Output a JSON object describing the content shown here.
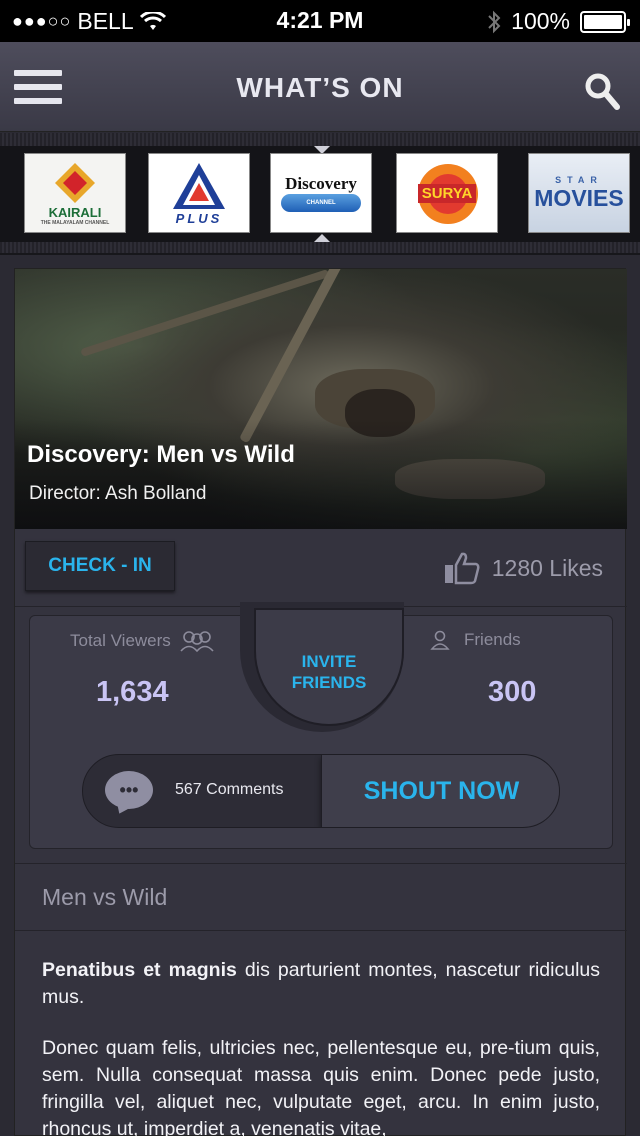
{
  "status_bar": {
    "signal": "●●●○○",
    "carrier": "BELL",
    "time": "4:21 PM",
    "battery": "100%"
  },
  "header": {
    "title": "WHAT’S ON"
  },
  "channels": [
    {
      "name": "KAIRALI",
      "sub": "THE MALAYALAM CHANNEL"
    },
    {
      "name": "PLUS",
      "sub": ""
    },
    {
      "name": "Discovery",
      "sub": "CHANNEL"
    },
    {
      "name": "SURYA",
      "sub": ""
    },
    {
      "name": "MOVIES",
      "sub": "STAR"
    }
  ],
  "show": {
    "title": "Discovery: Men vs Wild",
    "director": "Director: Ash Bolland"
  },
  "actions": {
    "checkin_label": "CHECK - IN",
    "likes_label": "1280 Likes"
  },
  "stats": {
    "total_viewers_label": "Total Viewers",
    "total_viewers_value": "1,634",
    "friends_label": "Friends",
    "friends_value": "300",
    "invite_line1": "INVITE",
    "invite_line2": "FRIENDS",
    "comments_label": "567 Comments",
    "shout_label": "SHOUT NOW"
  },
  "section": {
    "title": "Men vs Wild",
    "para1_bold": "Penatibus et magnis",
    "para1_rest": " dis parturient montes, nascetur ridiculus mus.",
    "para2": "Donec quam felis, ultricies nec, pellentesque eu, pre-tium quis, sem. Nulla consequat massa quis enim. Donec pede justo, fringilla vel, aliquet nec, vulputate eget, arcu. In enim justo, rhoncus ut, imperdiet a, venenatis vitae,"
  }
}
